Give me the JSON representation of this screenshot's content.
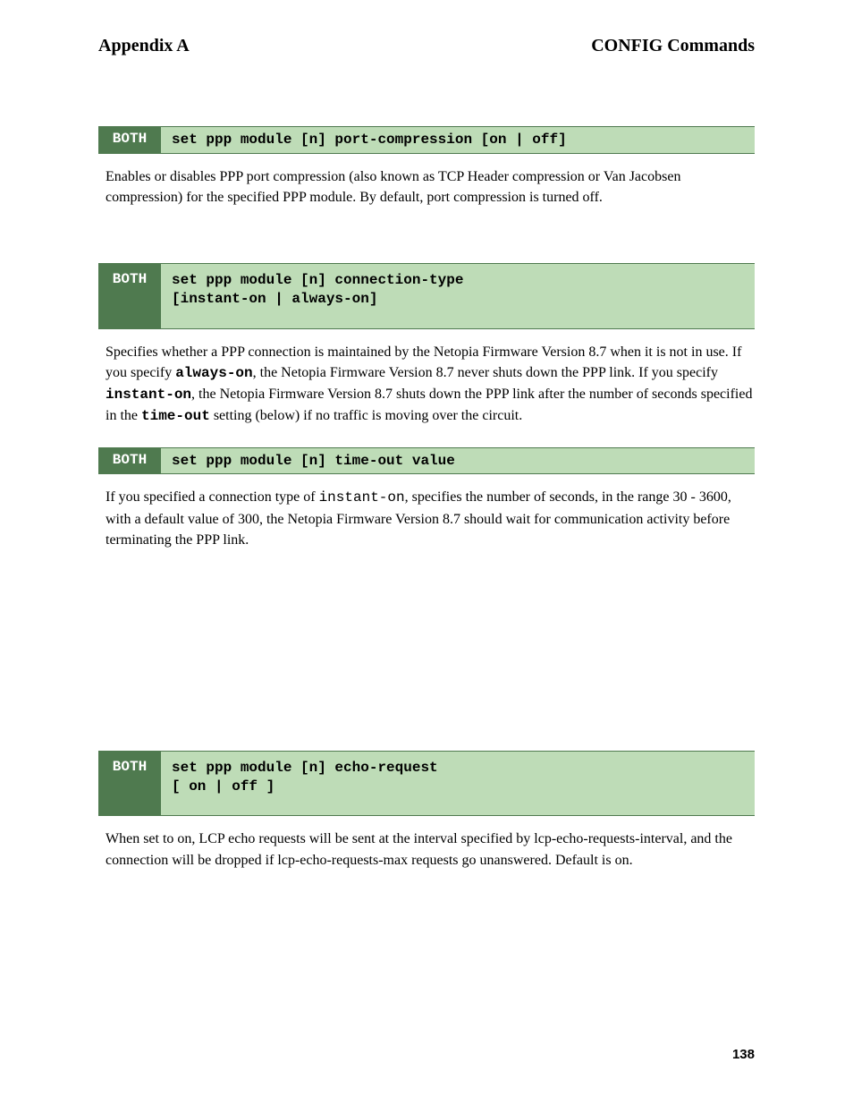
{
  "header": {
    "left": "Appendix A",
    "right": "CONFIG Commands"
  },
  "blocks": [
    {
      "tag": "BOTH",
      "tall": false,
      "cmd_html": "set ppp module [n] port-compression [on | off]",
      "body_html": "Enables or disables PPP port compression (also known as TCP Header compression or Van Jacobsen compression) for the specified PPP module. By default, port compression is turned off."
    },
    {
      "tag": "BOTH",
      "tall": true,
      "cmd_html": "set ppp module [n] connection-type<br>[instant-on | always-on]",
      "body_html": "Specifies whether a PPP connection is maintained by the Netopia Firmware Version 8.7 when it is not in use. If you specify <span class=\"mono bold\">always-on</span>, the Netopia Firmware Version 8.7 never shuts down the PPP link. If you specify <span class=\"mono bold\">instant-on</span>, the Netopia Firmware Version 8.7 shuts down the PPP link after the number of seconds specified in the <span class=\"mono bold\">time-out</span> setting (below) if no traffic is moving over the circuit."
    },
    {
      "tag": "BOTH",
      "tall": false,
      "cmd_html": "set ppp module [n] time-out value",
      "body_html": "If you specified a connection type of <span class=\"mono\">instant-on</span>, specifies the number of seconds, in the range 30 - 3600, with a default value of 300, the Netopia Firmware Version 8.7 should wait for communication activity before terminating the PPP link."
    },
    {
      "tag": "BOTH",
      "tall": true,
      "cmd_html": "set ppp module [n] echo-request<br>[ on | off ]",
      "body_html": "When set to on, LCP echo requests will be sent at the interval specified by lcp-echo-requests-interval, and the connection will be dropped if lcp-echo-requests-max requests go unanswered. Default is on."
    }
  ],
  "page_number": "138"
}
